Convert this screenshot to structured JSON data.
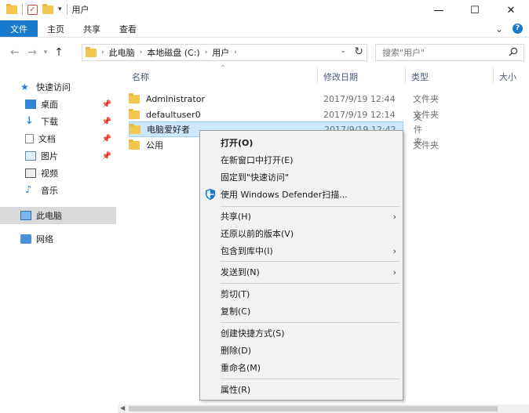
{
  "window": {
    "title": "用户",
    "minimize": "—",
    "maximize": "☐",
    "close": "✕"
  },
  "ribbon": {
    "tabs": [
      "文件",
      "主页",
      "共享",
      "查看"
    ],
    "collapse": "⌄",
    "help": "?"
  },
  "address": {
    "crumbs": [
      "此电脑",
      "本地磁盘 (C:)",
      "用户"
    ],
    "search_placeholder": "搜索\"用户\""
  },
  "sidebar": {
    "items": [
      {
        "label": "快速访问",
        "icon": "star-icon"
      },
      {
        "label": "桌面",
        "icon": "desktop-icon",
        "pinned": true
      },
      {
        "label": "下载",
        "icon": "download-icon",
        "pinned": true
      },
      {
        "label": "文档",
        "icon": "document-icon",
        "pinned": true
      },
      {
        "label": "图片",
        "icon": "picture-icon",
        "pinned": true
      },
      {
        "label": "视频",
        "icon": "video-icon"
      },
      {
        "label": "音乐",
        "icon": "music-icon"
      },
      {
        "label": "此电脑",
        "icon": "computer-icon",
        "selected": true
      },
      {
        "label": "网络",
        "icon": "network-icon"
      }
    ]
  },
  "columns": {
    "name": "名称",
    "date": "修改日期",
    "type": "类型",
    "size": "大小"
  },
  "files": [
    {
      "name": "Administrator",
      "date": "2017/9/19 12:44",
      "type": "文件夹"
    },
    {
      "name": "defaultuser0",
      "date": "2017/9/19 12:14",
      "type": "文件夹"
    },
    {
      "name": "电脑爱好者",
      "date": "2017/9/19 12:42",
      "type": "文件夹"
    },
    {
      "name": "公用",
      "date": "",
      "type": "文件夹"
    }
  ],
  "context_menu": {
    "open": "打开(O)",
    "open_new_window": "在新窗口中打开(E)",
    "pin_quick_access": "固定到\"快速访问\"",
    "defender_scan": "使用 Windows Defender扫描...",
    "share": "共享(H)",
    "restore_versions": "还原以前的版本(V)",
    "include_library": "包含到库中(I)",
    "send_to": "发送到(N)",
    "cut": "剪切(T)",
    "copy": "复制(C)",
    "create_shortcut": "创建快捷方式(S)",
    "delete": "删除(D)",
    "rename": "重命名(M)",
    "properties": "属性(R)"
  },
  "colors": {
    "accent": "#1979ca",
    "selection": "#cce8ff",
    "folder": "#f3c74f"
  }
}
